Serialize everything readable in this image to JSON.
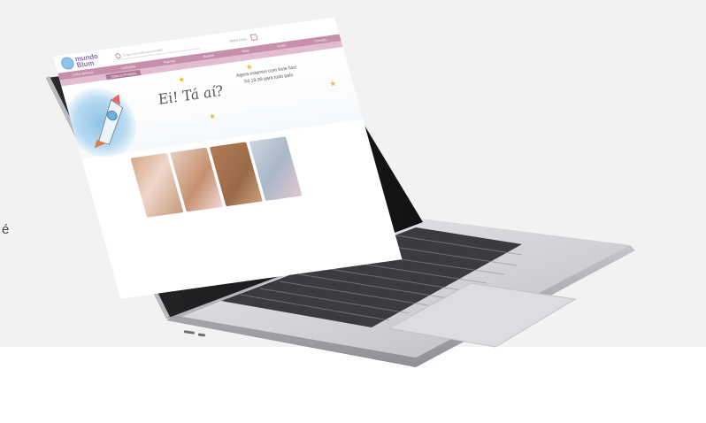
{
  "side_text": "é",
  "colors": {
    "background": "#f2f2f2",
    "nav_pink": "#c690ac",
    "laptop_silver": "#d3d4d6",
    "bezel": "#1b1b1d"
  },
  "website": {
    "logo": {
      "line1": "mundo",
      "line2": "Blum"
    },
    "search_placeholder": "O que você está procurando?",
    "account_label": "Minha conta",
    "cart_icon": "cart-icon",
    "nav_items": [
      "Linha Soneca",
      "Coleções",
      "Pijamas",
      "Bodies",
      "Mais",
      "Outlet",
      "Contato"
    ],
    "subnav_label": "Todos os Produtos",
    "banner": {
      "handwritten": "Ei! Tá aí?",
      "message_line1": "Agora estamos com frete fixo!",
      "message_line2": "Só 19,99 para todo país"
    }
  }
}
